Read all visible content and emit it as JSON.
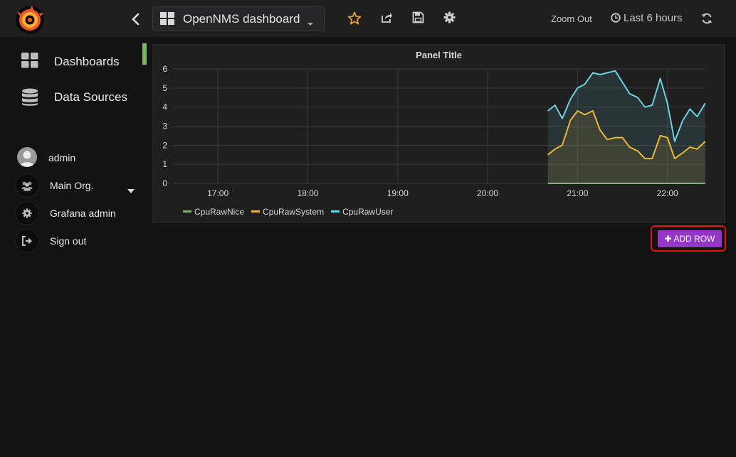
{
  "topbar": {
    "dashboard_title": "OpenNMS dashboard",
    "zoom_out_label": "Zoom Out",
    "time_range_label": "Last 6 hours"
  },
  "sidebar": {
    "items": [
      {
        "label": "Dashboards",
        "icon": "dashboards-grid-icon"
      },
      {
        "label": "Data Sources",
        "icon": "database-icon"
      }
    ],
    "user_menu": [
      {
        "label": "admin",
        "icon": "avatar"
      },
      {
        "label": "Main Org.",
        "icon": "users-icon"
      },
      {
        "label": "Grafana admin",
        "icon": "gear-icon"
      },
      {
        "label": "Sign out",
        "icon": "sign-out-icon"
      }
    ],
    "active_color": "#7eb26d"
  },
  "panel": {
    "title": "Panel Title"
  },
  "add_row_label": "ADD ROW",
  "colors": {
    "accent_purple": "#9436c6",
    "highlight_red": "#ee1111",
    "star_orange": "#eb9e34"
  },
  "chart_data": {
    "type": "area",
    "title": "Panel Title",
    "x_ticks": [
      "17:00",
      "18:00",
      "19:00",
      "20:00",
      "21:00",
      "22:00"
    ],
    "y_ticks": [
      0,
      1,
      2,
      3,
      4,
      5,
      6
    ],
    "ylim": [
      0,
      6
    ],
    "xlim_hours": [
      16.5,
      22.43
    ],
    "grid": true,
    "legend_position": "bottom-left",
    "x": [
      20.67,
      20.75,
      20.83,
      20.92,
      21.0,
      21.08,
      21.17,
      21.25,
      21.33,
      21.42,
      21.5,
      21.58,
      21.67,
      21.75,
      21.83,
      21.92,
      22.0,
      22.08,
      22.17,
      22.25,
      22.33,
      22.42
    ],
    "series": [
      {
        "name": "CpuRawNice",
        "color": "#7eb26d",
        "values": [
          0,
          0,
          0,
          0,
          0,
          0,
          0,
          0,
          0,
          0,
          0,
          0,
          0,
          0,
          0,
          0,
          0,
          0,
          0,
          0,
          0,
          0
        ]
      },
      {
        "name": "CpuRawSystem",
        "color": "#eab839",
        "values": [
          1.5,
          1.8,
          2.0,
          3.3,
          3.8,
          3.6,
          3.8,
          2.8,
          2.3,
          2.4,
          2.4,
          1.9,
          1.7,
          1.3,
          1.3,
          2.5,
          2.4,
          1.3,
          1.6,
          1.9,
          1.8,
          2.2
        ]
      },
      {
        "name": "CpuRawUser",
        "color": "#6ed0e0",
        "values": [
          3.8,
          4.1,
          3.4,
          4.4,
          5.0,
          5.2,
          5.8,
          5.7,
          5.8,
          5.9,
          5.3,
          4.7,
          4.5,
          4.0,
          4.1,
          5.5,
          4.2,
          2.2,
          3.3,
          3.9,
          3.5,
          4.2
        ]
      }
    ]
  }
}
